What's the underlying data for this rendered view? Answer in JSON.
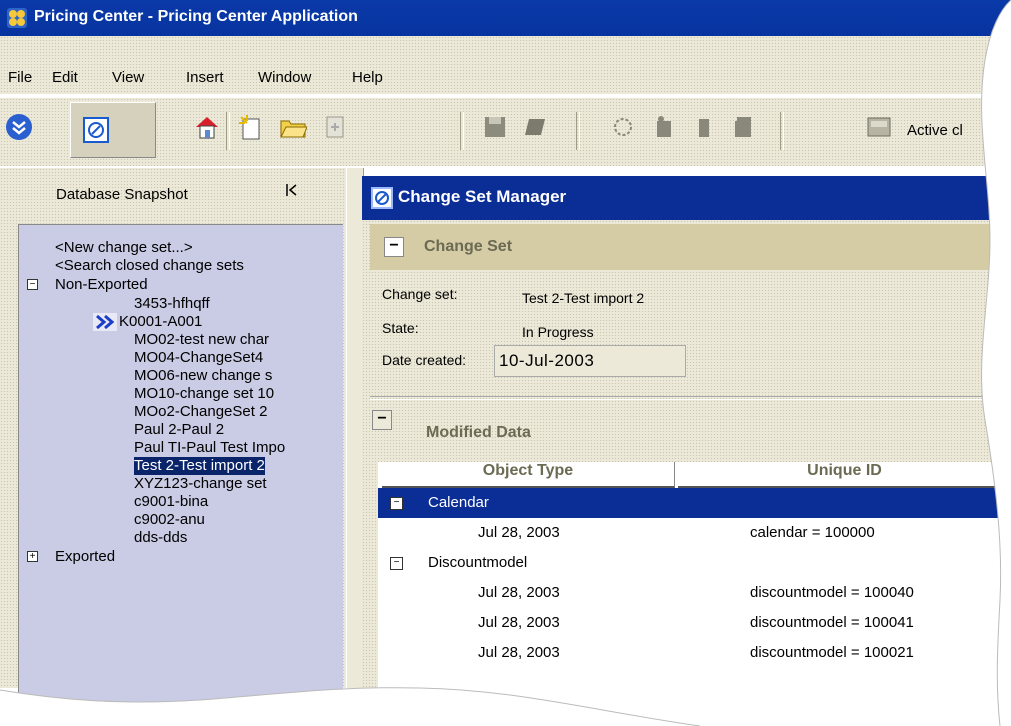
{
  "window": {
    "title": "Pricing Center - Pricing Center Application"
  },
  "menu": [
    "File",
    "Edit",
    "View",
    "Insert",
    "Window",
    "Help"
  ],
  "toolbar": {
    "active_label": "Active cl"
  },
  "left_panel": {
    "title": "Database Snapshot",
    "collapse_glyph": "⟨",
    "tree": {
      "new_change_set": "<New change set...>",
      "search_closed": "<Search closed change sets",
      "non_exported": "Non-Exported",
      "items": [
        "3453-hfhqff",
        "K0001-A001",
        "MO02-test new char",
        "MO04-ChangeSet4",
        "MO06-new change s",
        "MO10-change set 10",
        "MOo2-ChangeSet 2",
        "Paul 2-Paul 2",
        "Paul TI-Paul Test Impo",
        "Test 2-Test import 2",
        "XYZ123-change set",
        "c9001-bina",
        "c9002-anu",
        "dds-dds"
      ],
      "selected": "Test 2-Test import 2",
      "exported": "Exported"
    }
  },
  "change_set_manager": {
    "title": "Change Set Manager",
    "change_set_section": "Change Set",
    "fields": {
      "change_set_label": "Change set:",
      "change_set_value": "Test 2-Test import 2",
      "state_label": "State:",
      "state_value": "In Progress",
      "date_label": "Date created:",
      "date_value": "10-Jul-2003"
    },
    "modified_data_section": "Modified Data",
    "columns": [
      "Object Type",
      "Unique ID"
    ],
    "groups": [
      {
        "name": "Calendar",
        "rows": [
          {
            "date": "Jul 28, 2003",
            "id": "calendar = 100000"
          }
        ]
      },
      {
        "name": "Discountmodel",
        "rows": [
          {
            "date": "Jul 28, 2003",
            "id": "discountmodel = 100040"
          },
          {
            "date": "Jul 28, 2003",
            "id": "discountmodel = 100041"
          },
          {
            "date": "Jul 28, 2003",
            "id": "discountmodel = 100021"
          }
        ]
      }
    ]
  }
}
